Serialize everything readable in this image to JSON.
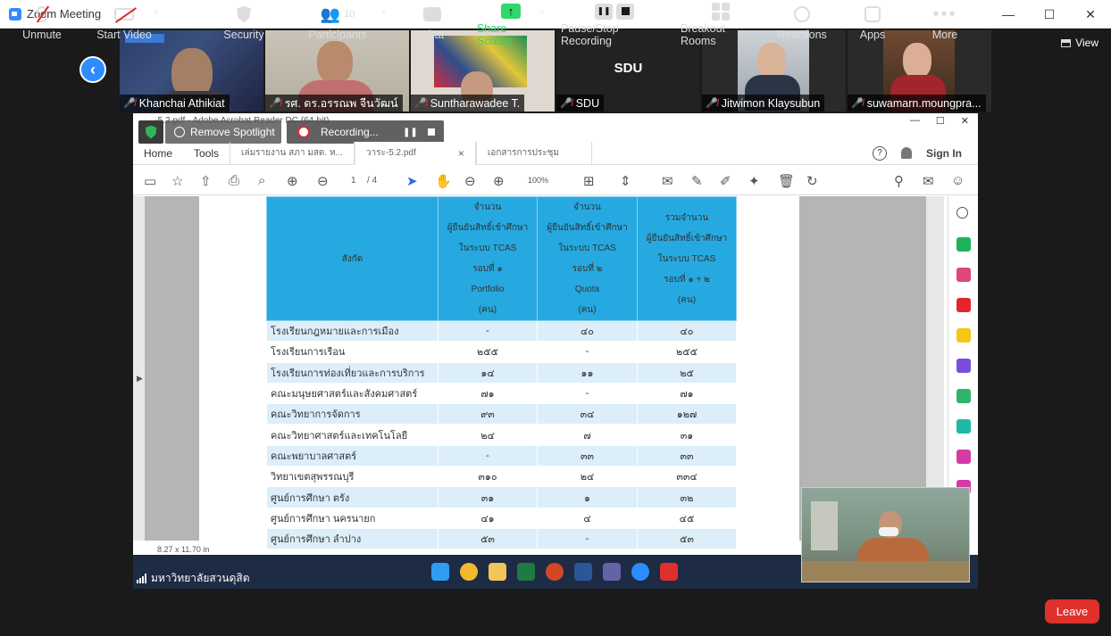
{
  "window": {
    "title": "Zoom Meeting",
    "controls": [
      "—",
      "☐",
      "✕"
    ]
  },
  "top_controls": {
    "view_label": "View"
  },
  "participants": [
    {
      "name": "Khanchai Athikiat"
    },
    {
      "name": "รศ. ดร.อรรณพ จีนวัฒน์"
    },
    {
      "name": "Suntharawadee T."
    },
    {
      "name": "SDU",
      "display": "SDU"
    },
    {
      "name": "Jitwimon Klaysubun"
    },
    {
      "name": "suwamarn.moungpra..."
    }
  ],
  "share": {
    "acrobat_title": "...-5.2.pdf - Adobe Acrobat Reader DC (64-bit)",
    "window_ctrls": [
      "—",
      "☐",
      "✕"
    ],
    "spotlight_label": "Remove Spotlight",
    "recording_label": "Recording...",
    "tabs": {
      "home": "Home",
      "tools": "Tools",
      "doc1": "เล่มรายงาน สภา มสด. ห...",
      "doc2": "วาระ-5.2.pdf",
      "doc2_close": "×",
      "doc3": "เอกสารการประชุม",
      "help": "?",
      "sign_in": "Sign In"
    },
    "page_indicator": {
      "current": "1",
      "total": "/ 4"
    },
    "zoom_value": "100%",
    "page_size": "8.27 x 11.70 in",
    "table": {
      "header": {
        "col0": "สังกัด",
        "col1": [
          "จำนวน",
          "ผู้ยืนยันสิทธิ์เข้าศึกษา",
          "ในระบบ TCAS",
          "รอบที่ ๑",
          "Portfolio",
          "(คน)"
        ],
        "col2": [
          "จำนวน",
          "ผู้ยืนยันสิทธิ์เข้าศึกษา",
          "ในระบบ TCAS",
          "รอบที่ ๒",
          "Quota",
          "(คน)"
        ],
        "col3": [
          "รวมจำนวน",
          "ผู้ยืนยันสิทธิ์เข้าศึกษา",
          "ในระบบ TCAS",
          "รอบที่ ๑ + ๒",
          "(คน)"
        ]
      },
      "rows": [
        [
          "โรงเรียนกฎหมายและการเมือง",
          "-",
          "๔๐",
          "๔๐"
        ],
        [
          "โรงเรียนการเรือน",
          "๒๕๕",
          "-",
          "๒๕๕"
        ],
        [
          "โรงเรียนการท่องเที่ยวและการบริการ",
          "๑๔",
          "๑๑",
          "๒๕"
        ],
        [
          "คณะมนุษยศาสตร์และสังคมศาสตร์",
          "๗๑",
          "-",
          "๗๑"
        ],
        [
          "คณะวิทยาการจัดการ",
          "๙๓",
          "๓๔",
          "๑๒๗"
        ],
        [
          "คณะวิทยาศาสตร์และเทคโนโลยี",
          "๒๔",
          "๗",
          "๓๑"
        ],
        [
          "คณะพยาบาลศาสตร์",
          "-",
          "๓๓",
          "๓๓"
        ],
        [
          "วิทยาเขตสุพรรณบุรี",
          "๓๑๐",
          "๒๔",
          "๓๓๔"
        ],
        [
          "ศูนย์การศึกษา ตรัง",
          "๓๑",
          "๑",
          "๓๒"
        ],
        [
          "ศูนย์การศึกษา นครนายก",
          "๔๑",
          "๔",
          "๔๕"
        ],
        [
          "ศูนย์การศึกษา ลำปาง",
          "๕๓",
          "-",
          "๕๓"
        ]
      ]
    },
    "sharer_status": "มหาวิทยาลัยสวนดุสิต"
  },
  "toolbar": {
    "unmute": "Unmute",
    "start_video": "Start Video",
    "security": "Security",
    "participants": "Participants",
    "participants_count": "10",
    "chat": "Chat",
    "share_screen": "Share Screen",
    "pause_stop_recording": "Pause/Stop Recording",
    "breakout_rooms": "Breakout Rooms",
    "reactions": "Reactions",
    "apps": "Apps",
    "more": "More",
    "leave": "Leave"
  },
  "colors": {
    "zoom_blue": "#2d8cff",
    "share_green": "#2fd86a",
    "leave_red": "#e0302c",
    "table_header": "#26a9e0",
    "table_alt_row": "#dbeefa"
  }
}
